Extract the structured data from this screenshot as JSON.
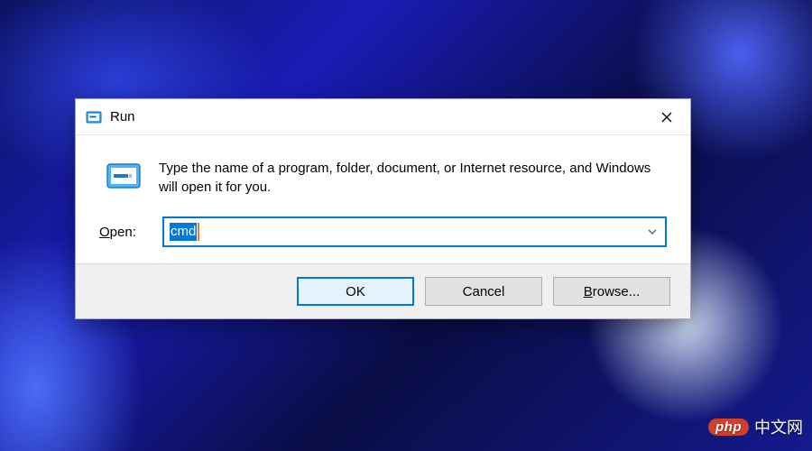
{
  "dialog": {
    "title": "Run",
    "description": "Type the name of a program, folder, document, or Internet resource, and Windows will open it for you.",
    "open_label_prefix": "O",
    "open_label_rest": "pen:",
    "input_value": "cmd",
    "buttons": {
      "ok": "OK",
      "cancel": "Cancel",
      "browse_prefix": "B",
      "browse_rest": "rowse..."
    }
  },
  "watermark": {
    "badge": "php",
    "text": "中文网"
  }
}
